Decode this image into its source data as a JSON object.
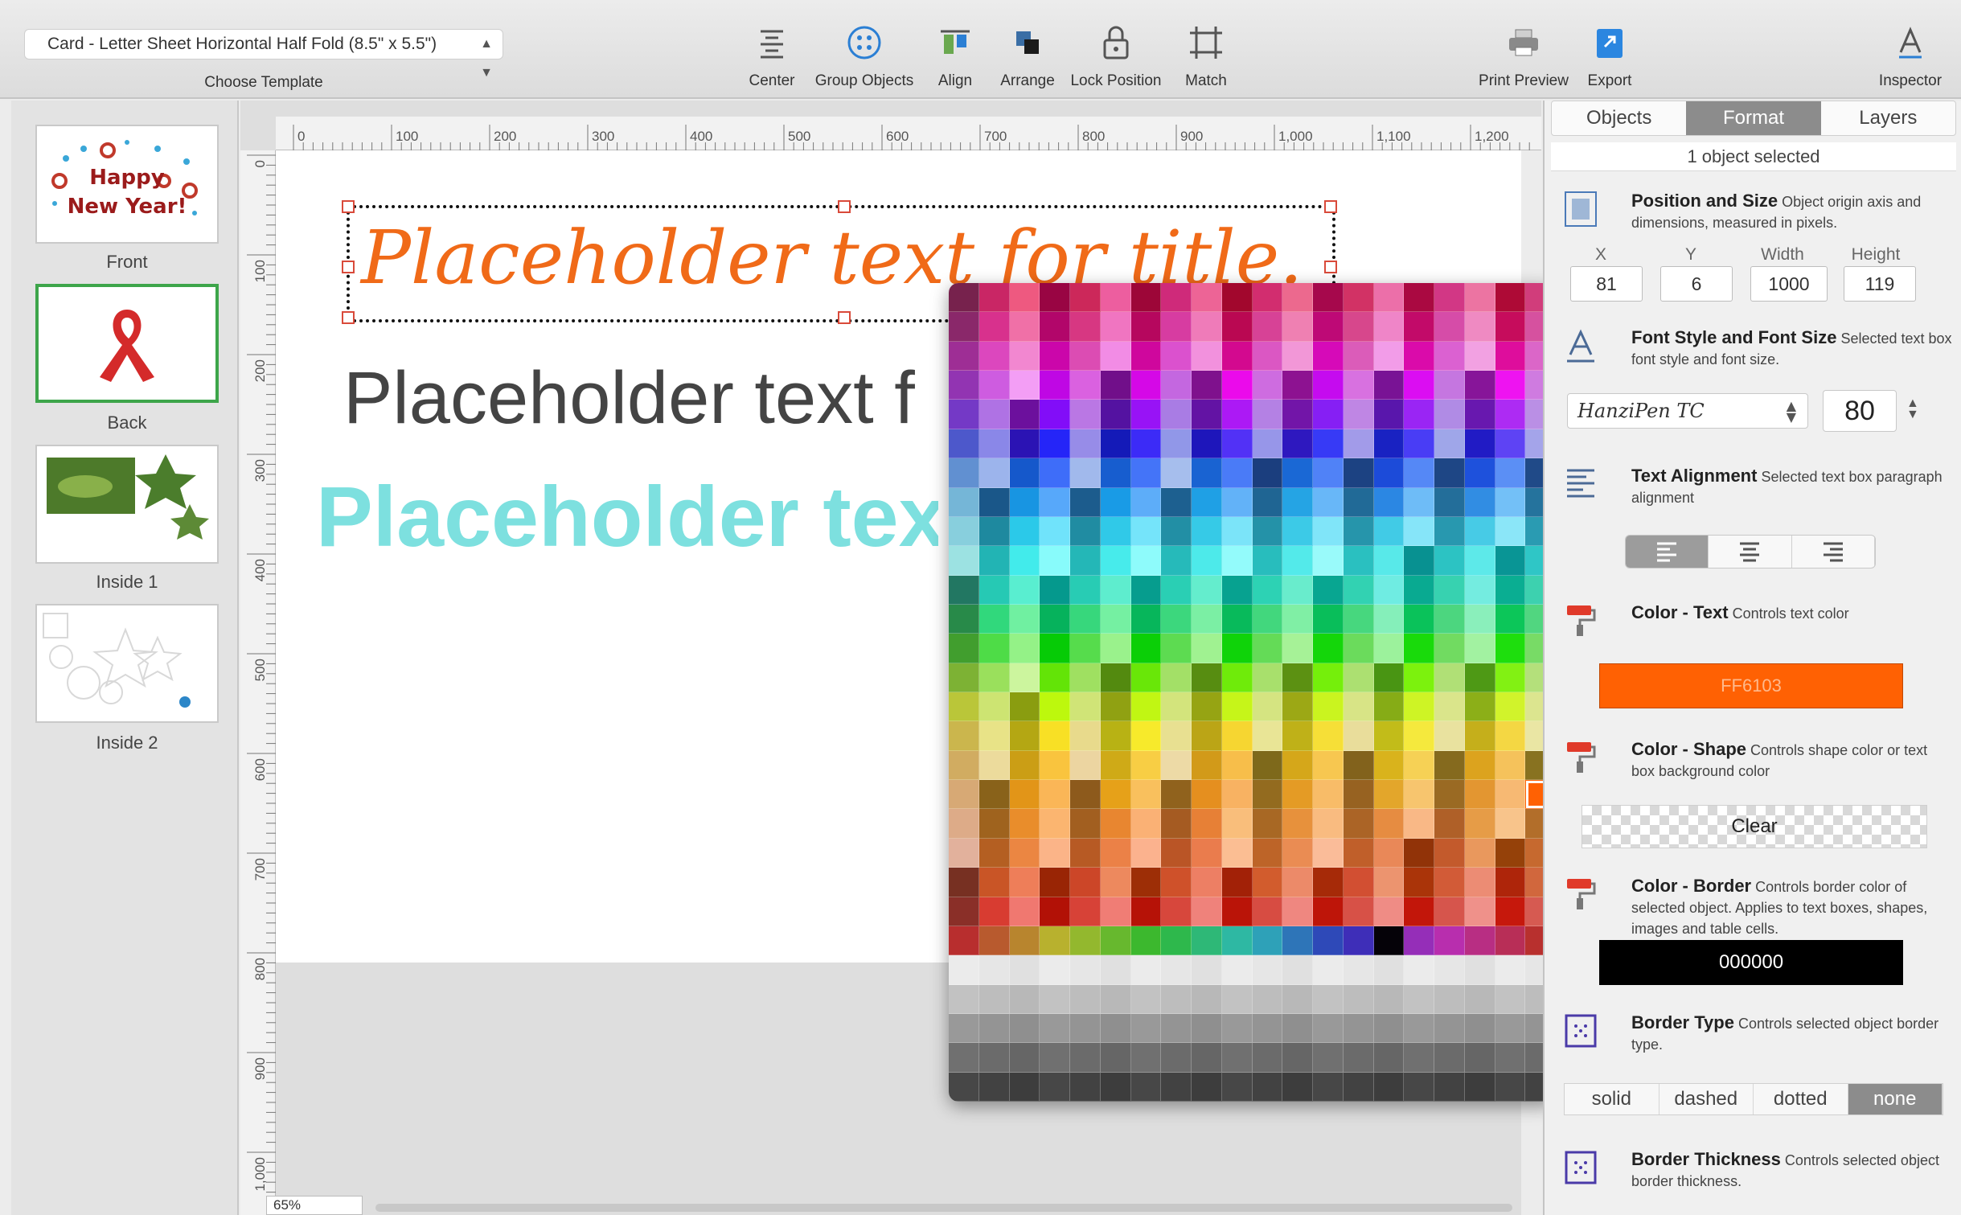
{
  "toolbar": {
    "template_value": "Card - Letter Sheet Horizontal Half Fold (8.5\" x 5.5\")",
    "template_caption": "Choose Template",
    "tools": [
      {
        "label": "Center"
      },
      {
        "label": "Group Objects"
      },
      {
        "label": "Align"
      },
      {
        "label": "Arrange"
      },
      {
        "label": "Lock Position"
      },
      {
        "label": "Match"
      },
      {
        "label": "Print Preview"
      },
      {
        "label": "Export"
      },
      {
        "label": "Inspector"
      }
    ]
  },
  "pages": [
    {
      "label": "Front",
      "thumb_line1": "Happy",
      "thumb_line2": "New Year!"
    },
    {
      "label": "Back"
    },
    {
      "label": "Inside 1"
    },
    {
      "label": "Inside 2"
    }
  ],
  "rulers": {
    "h_ticks": [
      "0",
      "100",
      "200",
      "300",
      "400",
      "500",
      "600",
      "700",
      "800",
      "900",
      "1,000",
      "1,100",
      "1,200"
    ],
    "v_ticks": [
      "0",
      "100",
      "200",
      "300",
      "400",
      "500",
      "600",
      "700",
      "800",
      "900",
      "1,000"
    ]
  },
  "canvas": {
    "title_text": "Placeholder text for title.",
    "text2": "Placeholder text f",
    "text3": "Placeholder text f",
    "zoom": "65%"
  },
  "inspector": {
    "tabs": [
      "Objects",
      "Format",
      "Layers"
    ],
    "active_tab": "Format",
    "selection_status": "1 object selected",
    "position": {
      "title": "Position and Size",
      "desc": "Object origin axis and dimensions, measured in pixels.",
      "labels": [
        "X",
        "Y",
        "Width",
        "Height"
      ],
      "values": [
        "81",
        "6",
        "1000",
        "119"
      ]
    },
    "font": {
      "title": "Font Style and Font Size",
      "desc": "Selected text box font style and font size.",
      "family": "HanziPen TC",
      "size": "80"
    },
    "alignment": {
      "title": "Text Alignment",
      "desc": "Selected text box paragraph alignment"
    },
    "text_color": {
      "title": "Color - Text",
      "desc": "Controls text color",
      "value": "FF6103",
      "hex": "#ff6103"
    },
    "shape_color": {
      "title": "Color - Shape",
      "desc": "Controls shape color or text box background color",
      "value": "Clear"
    },
    "border_color": {
      "title": "Color - Border",
      "desc": "Controls border color of selected object.  Applies to text boxes, shapes, images and table cells.",
      "value": "000000",
      "hex": "#000000"
    },
    "border_type": {
      "title": "Border Type",
      "desc": "Controls selected object border type.",
      "options": [
        "solid",
        "dashed",
        "dotted",
        "none"
      ],
      "selected": "none"
    },
    "border_thickness": {
      "title": "Border Thickness",
      "desc": "Controls selected object border thickness."
    }
  }
}
